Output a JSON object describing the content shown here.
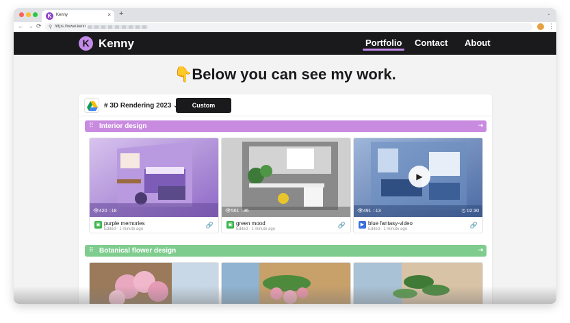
{
  "browser": {
    "tab_title": "Kenny",
    "tab_favicon": "K",
    "url": "https://www.kenn",
    "close_glyph": "×",
    "newtab_glyph": "+",
    "tab_menu_glyph": "⌄",
    "back_glyph": "←",
    "forward_glyph": "→",
    "reload_glyph": "⟳",
    "lock_glyph": "⚲",
    "menu_glyph": "⋮"
  },
  "nav": {
    "logo_letter": "K",
    "brand": "Kenny",
    "links": [
      {
        "label": "Portfolio",
        "active": true
      },
      {
        "label": "Contact",
        "active": false
      },
      {
        "label": "About",
        "active": false
      }
    ]
  },
  "hero": {
    "emoji": "👇",
    "title": "Below you can see my work."
  },
  "toolbar": {
    "folder_name": "# 3D Rendering 2023",
    "folder_chevron": "⌄",
    "custom_button": "Custom"
  },
  "sections": [
    {
      "title": "Interior design",
      "color": "#c98be0",
      "items": [
        {
          "name": "purple memories",
          "meta": "Edited · 1 minute ago",
          "views": "420",
          "comments": "18",
          "type": "image"
        },
        {
          "name": "green mood",
          "meta": "Edited · 1 minute ago",
          "views": "561",
          "comments": "36",
          "type": "image"
        },
        {
          "name": "blue fantasy-video",
          "meta": "Edited · 1 minute ago",
          "views": "491",
          "comments": "13",
          "type": "video",
          "duration": "02:30"
        }
      ]
    },
    {
      "title": "Botanical flower design",
      "color": "#7fcc8f",
      "items": []
    }
  ],
  "glyphs": {
    "grip": "⠿",
    "section_open": "⇥",
    "eye": "👁",
    "comment": "◌",
    "clock": "◷",
    "link": "🔗",
    "play": "▶",
    "image_file": "▣",
    "video_file": "▶"
  },
  "colors": {
    "accent": "#c38ae8",
    "nav_bg": "#1a1a1c",
    "image_file_icon": "#3bb54a",
    "video_file_icon": "#3b6fe0"
  }
}
